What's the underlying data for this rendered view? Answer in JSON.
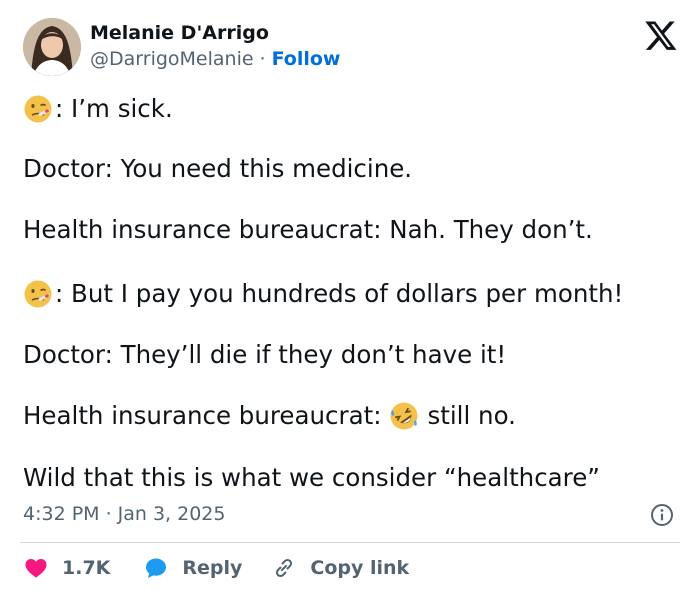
{
  "author": {
    "name": "Melanie D'Arrigo",
    "handle": "@DarrigoMelanie",
    "separator": "·",
    "follow_label": "Follow"
  },
  "tweet": {
    "lines": [
      {
        "emoji": "sick-face-emoji",
        "text": ": I’m sick."
      },
      {
        "text": "Doctor: You need this medicine."
      },
      {
        "text": "Health insurance bureaucrat: Nah. They don’t."
      },
      {
        "emoji": "sick-face-emoji",
        "text": ": But I pay you hundreds of dollars per month!"
      },
      {
        "text": "Doctor: They’ll die if they don’t have it!"
      },
      {
        "text_before": "Health insurance bureaucrat:",
        "emoji": "rolling-on-floor-laughing-emoji",
        "text_after": "still no."
      },
      {
        "text": "Wild that this is what we consider “healthcare”"
      }
    ]
  },
  "meta": {
    "time": "4:32 PM",
    "separator": "·",
    "date": "Jan 3, 2025"
  },
  "actions": {
    "likes": "1.7K",
    "reply_label": "Reply",
    "copy_link_label": "Copy link"
  },
  "colors": {
    "text": "#0f1419",
    "secondary": "#536471",
    "link": "#006fd6",
    "heart": "#f91880",
    "reply_bubble": "#1d9bf0",
    "divider": "#cfd9de"
  },
  "icons": [
    "x-logo-icon",
    "info-icon",
    "heart-icon",
    "reply-bubble-icon",
    "link-icon"
  ]
}
